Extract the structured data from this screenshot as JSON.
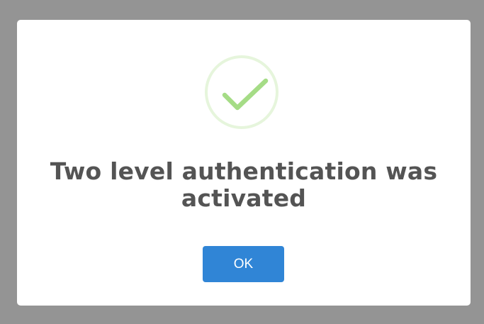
{
  "dialog": {
    "icon": "success-checkmark-icon",
    "title": "Two level authentication was activated",
    "ok_label": "OK"
  },
  "colors": {
    "backdrop": "#949494",
    "dialog_background": "#ffffff",
    "title_text": "#545454",
    "check_ring": "#e6f5dc",
    "check_mark": "#a5dc86",
    "button_background": "#3085d6",
    "button_text": "#ffffff"
  }
}
